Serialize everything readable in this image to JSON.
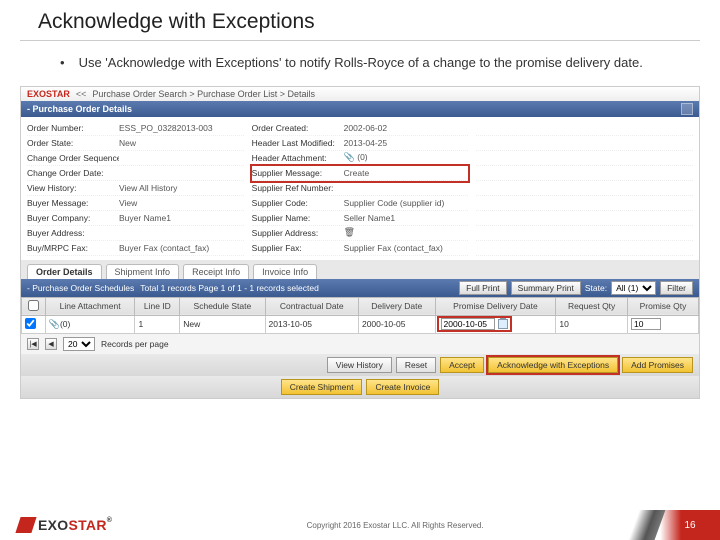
{
  "slide": {
    "title": "Acknowledge with Exceptions",
    "bullet": "Use 'Acknowledge with Exceptions' to notify Rolls-Royce of a change to the promise delivery date."
  },
  "breadcrumb": {
    "back": "<<",
    "path": "Purchase Order Search > Purchase Order List > Details"
  },
  "panel": {
    "title": "- Purchase Order Details"
  },
  "fields": {
    "c1": [
      {
        "l": "Order Number:",
        "v": "ESS_PO_03282013-003"
      },
      {
        "l": "Order State:",
        "v": "New"
      },
      {
        "l": "Change Order Sequence:",
        "v": ""
      },
      {
        "l": "Change Order Date:",
        "v": ""
      },
      {
        "l": "View History:",
        "v": "View All History"
      },
      {
        "l": "Buyer Message:",
        "v": "View"
      },
      {
        "l": "Buyer Company:",
        "v": "Buyer Name1"
      },
      {
        "l": "Buyer Address:",
        "v": ""
      },
      {
        "l": "Buy/MRPC Fax:",
        "v": "Buyer Fax (contact_fax)"
      }
    ],
    "c2": [
      {
        "l": "Order Created:",
        "v": "2002-06-02"
      },
      {
        "l": "Header Last Modified:",
        "v": "2013-04-25"
      },
      {
        "l": "Header Attachment:",
        "v": "__clip__"
      },
      {
        "l": "Supplier Message:",
        "v": "Create",
        "hl": true
      },
      {
        "l": "Supplier Ref Number:",
        "v": ""
      },
      {
        "l": "Supplier Code:",
        "v": "Supplier Code (supplier id)"
      },
      {
        "l": "Supplier Name:",
        "v": "Seller Name1"
      },
      {
        "l": "Supplier Address:",
        "v": "__trash__"
      },
      {
        "l": "Supplier Fax:",
        "v": "Supplier Fax (contact_fax)"
      }
    ],
    "c3": [
      {
        "l": "",
        "v": ""
      },
      {
        "l": "",
        "v": ""
      },
      {
        "l": "",
        "v": ""
      },
      {
        "l": "",
        "v": ""
      },
      {
        "l": "",
        "v": ""
      },
      {
        "l": "",
        "v": ""
      },
      {
        "l": "",
        "v": ""
      },
      {
        "l": "",
        "v": ""
      },
      {
        "l": "",
        "v": ""
      }
    ]
  },
  "tabs": [
    "Order Details",
    "Shipment Info",
    "Receipt Info",
    "Invoice Info"
  ],
  "sched": {
    "title": "- Purchase Order Schedules",
    "count": "Total 1 records Page 1 of 1 - 1 records selected",
    "btn_full": "Full Print",
    "btn_sum": "Summary Print",
    "state_label": "State:",
    "state_sel": "All (1)",
    "btn_filter": "Filter"
  },
  "grid": {
    "headers": [
      "",
      "Line Attachment",
      "Line ID",
      "Schedule State",
      "Contractual Date",
      "Delivery Date",
      "Promise Delivery Date",
      "Request Qty",
      "Promise Qty"
    ],
    "row": {
      "checked": true,
      "attach": "(0)",
      "line_id": "1",
      "state": "New",
      "contract_date": "2013-10-05",
      "delivery_date": "2000-10-05",
      "promise_date": "2000-10-05",
      "req_qty": "10",
      "prom_qty": "10"
    }
  },
  "pager": {
    "size": "20",
    "label": "Records per page"
  },
  "actions": {
    "view_history": "View History",
    "reset": "Reset",
    "accept": "Accept",
    "ack_ex": "Acknowledge with Exceptions",
    "add_prom": "Add Promises",
    "create_ship": "Create Shipment",
    "create_inv": "Create Invoice"
  },
  "footer": {
    "logo1": "EXO",
    "logo2": "STAR",
    "reg": "®",
    "copyright": "Copyright 2016 Exostar LLC. All Rights Reserved.",
    "page": "16"
  }
}
